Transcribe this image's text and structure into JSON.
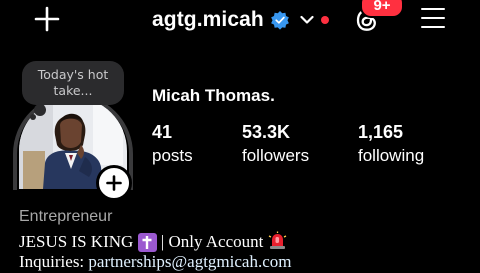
{
  "header": {
    "username": "agtg.micah",
    "notification_badge": "9+",
    "accent_verified": "#3897f0",
    "accent_alert": "#ff3040"
  },
  "icons": [
    "plus-icon",
    "verified-badge-icon",
    "chevron-down-icon",
    "threads-icon",
    "menu-icon",
    "add-story-plus-icon"
  ],
  "note": {
    "text": "Today's hot take..."
  },
  "profile": {
    "full_name": "Micah Thomas.",
    "stats": [
      {
        "value": "41",
        "label": "posts"
      },
      {
        "value": "53.3K",
        "label": "followers"
      },
      {
        "value": "1,165",
        "label": "following"
      }
    ]
  },
  "bio": {
    "category": "Entrepreneur",
    "line1_a": "JESUS IS KING",
    "line1_emoji1": "✝️",
    "line1_b": "| Only Account",
    "line1_emoji2": "🚨",
    "line2_prefix": "Inquiries: ",
    "line2_link": "partnerships@agtgmicah.com"
  }
}
